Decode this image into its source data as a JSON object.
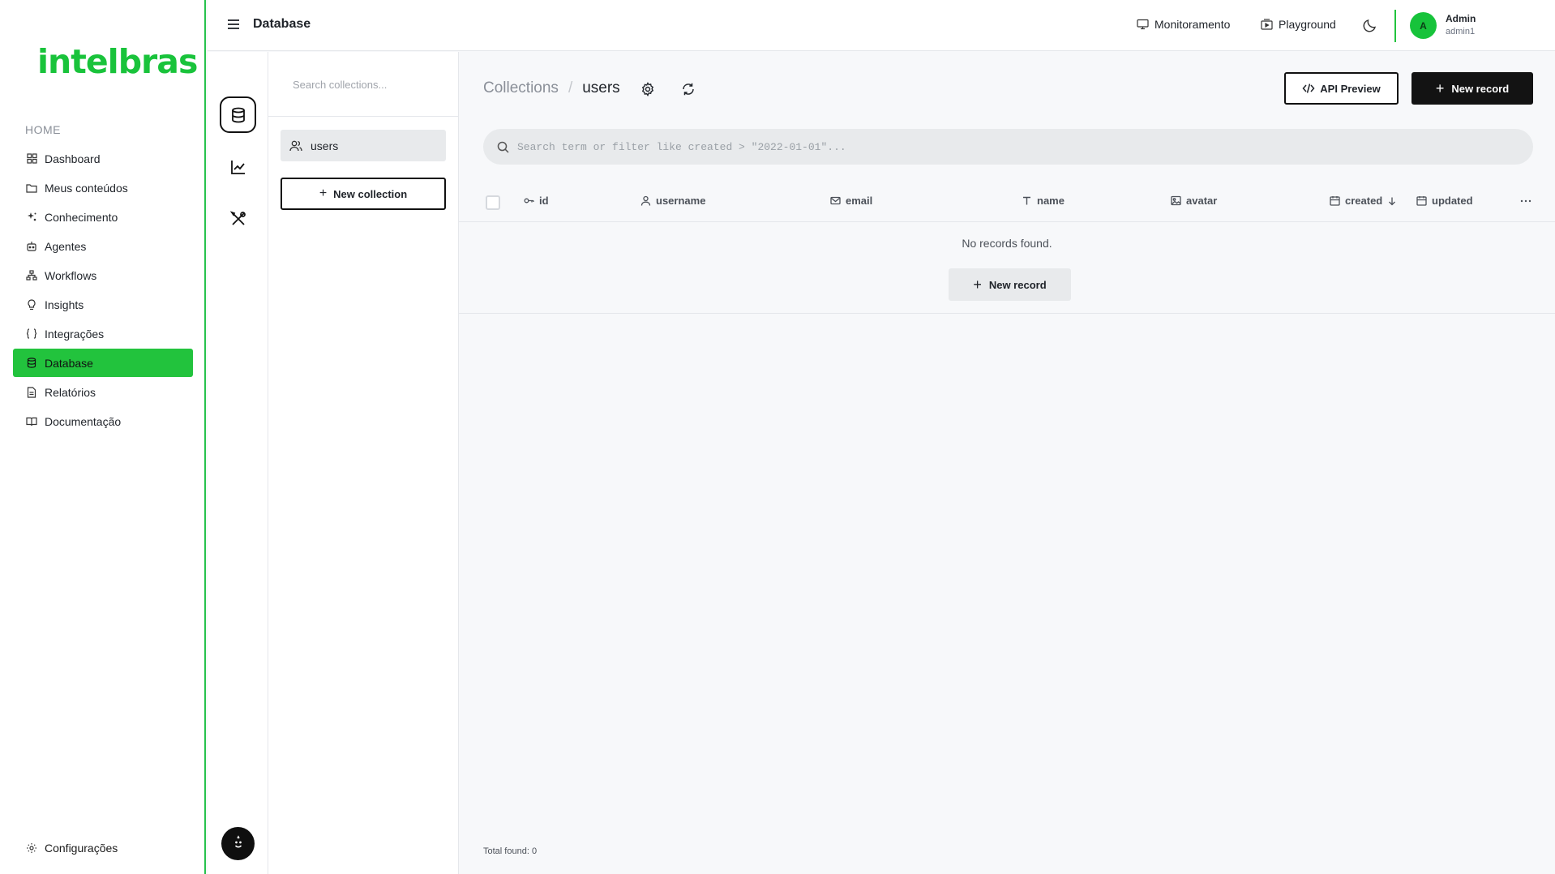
{
  "sidebar": {
    "logo": "intelbras",
    "section_header": "HOME",
    "items": [
      {
        "label": "Dashboard",
        "icon": "grid-icon"
      },
      {
        "label": "Meus conteúdos",
        "icon": "folder-icon"
      },
      {
        "label": "Conhecimento",
        "icon": "sparkle-icon"
      },
      {
        "label": "Agentes",
        "icon": "robot-icon"
      },
      {
        "label": "Workflows",
        "icon": "workflow-icon"
      },
      {
        "label": "Insights",
        "icon": "lightbulb-icon"
      },
      {
        "label": "Integrações",
        "icon": "braces-icon"
      },
      {
        "label": "Database",
        "icon": "database-icon",
        "active": true
      },
      {
        "label": "Relatórios",
        "icon": "report-icon"
      },
      {
        "label": "Documentação",
        "icon": "book-icon"
      }
    ],
    "footer_item": {
      "label": "Configurações",
      "icon": "gear-icon"
    },
    "accent_color": "#22c33d"
  },
  "header": {
    "title": "Database",
    "links": [
      {
        "label": "Monitoramento",
        "icon": "monitor-icon"
      },
      {
        "label": "Playground",
        "icon": "playground-icon"
      }
    ],
    "user": {
      "initial": "A",
      "name": "Admin",
      "login": "admin1"
    }
  },
  "collections_panel": {
    "search_placeholder": "Search collections...",
    "items": [
      {
        "label": "users",
        "icon": "users-icon"
      }
    ],
    "new_collection_label": "New collection"
  },
  "main": {
    "breadcrumb_root": "Collections",
    "breadcrumb_sep": "/",
    "breadcrumb_current": "users",
    "api_preview_label": "API Preview",
    "new_record_label": "New record",
    "search_placeholder": "Search term or filter like created > \"2022-01-01\"...",
    "columns": [
      {
        "label": "id",
        "icon": "key-icon"
      },
      {
        "label": "username",
        "icon": "user-icon"
      },
      {
        "label": "email",
        "icon": "mail-icon"
      },
      {
        "label": "name",
        "icon": "text-icon"
      },
      {
        "label": "avatar",
        "icon": "image-icon"
      },
      {
        "label": "created",
        "icon": "calendar-icon",
        "sort": "desc"
      },
      {
        "label": "updated",
        "icon": "calendar-icon"
      }
    ],
    "empty_text": "No records found.",
    "empty_new_record_label": "New record",
    "total_found_label": "Total found:",
    "total_found_value": "0"
  }
}
